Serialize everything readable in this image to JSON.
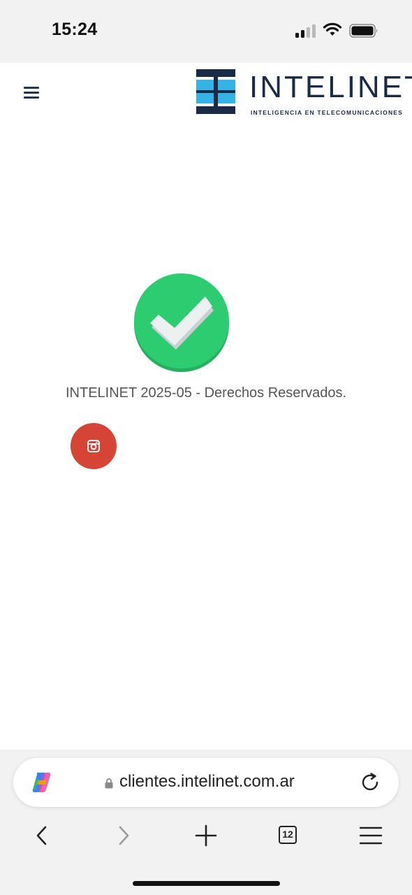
{
  "status_bar": {
    "time": "15:24"
  },
  "header": {
    "logo_name": "INTELINET",
    "logo_tagline": "INTELIGENCIA EN TELECOMUNICACIONES",
    "menu_icon": "hamburger-menu-icon"
  },
  "main": {
    "status_icon": "check-icon",
    "footer_text": "INTELINET 2025-05 - Derechos Reservados.",
    "social_icon": "instagram-icon"
  },
  "browser": {
    "url": "clientes.intelinet.com.ar",
    "tab_count": "12"
  },
  "colors": {
    "brand_dark": "#1b2a45",
    "brand_blue": "#35b3e6",
    "success_green": "#2ecc71",
    "instagram_red": "#d64436"
  }
}
